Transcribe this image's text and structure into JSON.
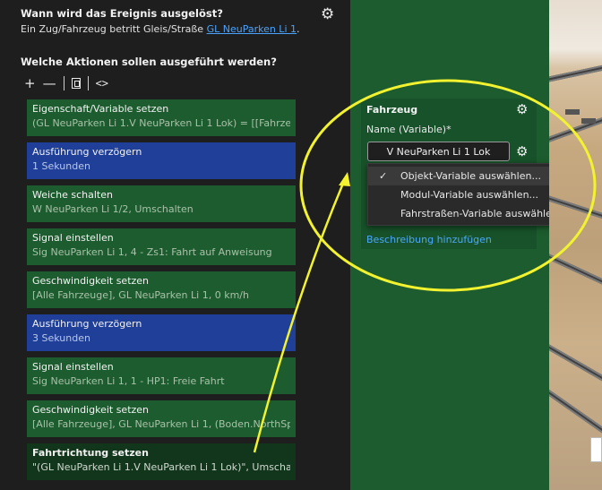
{
  "trigger": {
    "title": "Wann wird das Ereignis ausgelöst?",
    "text_prefix": "Ein Zug/Fahrzeug betritt Gleis/Straße ",
    "link": "GL NeuParken Li 1",
    "text_suffix": ".",
    "gear_icon": "gear-icon"
  },
  "actions_title": "Welche Aktionen sollen ausgeführt werden?",
  "toolbar": {
    "add": "+",
    "remove": "—",
    "code": "<>"
  },
  "actions": [
    {
      "title": "Eigenschaft/Variable setzen",
      "sub": "(GL NeuParken Li 1.V NeuParken Li 1 Lok) = [[Fahrze...",
      "style": "green"
    },
    {
      "title": "Ausführung verzögern",
      "sub": "1 Sekunden",
      "style": "blue"
    },
    {
      "title": "Weiche schalten",
      "sub": "W NeuParken Li 1/2, Umschalten",
      "style": "green"
    },
    {
      "title": "Signal einstellen",
      "sub": "Sig NeuParken Li 1, 4 - Zs1:  Fahrt auf Anweisung",
      "style": "green"
    },
    {
      "title": "Geschwindigkeit setzen",
      "sub": "[Alle Fahrzeuge], GL NeuParken Li 1, 0 km/h",
      "style": "green"
    },
    {
      "title": "Ausführung verzögern",
      "sub": "3 Sekunden",
      "style": "blue"
    },
    {
      "title": "Signal einstellen",
      "sub": "Sig NeuParken Li 1, 1 - HP1:  Freie Fahrt",
      "style": "green"
    },
    {
      "title": "Geschwindigkeit setzen",
      "sub": "[Alle Fahrzeuge], GL NeuParken Li 1, (Boden.NorthSp...",
      "style": "green"
    },
    {
      "title": "Fahrtrichtung setzen",
      "sub": "\"(GL NeuParken Li 1.V NeuParken Li 1 Lok)\", Umscha...",
      "style": "dark"
    }
  ],
  "vehicle_panel": {
    "title": "Fahrzeug",
    "name_label": "Name (Variable)*",
    "input_value": "V NeuParken Li 1 Lok",
    "description_link": "Beschreibung hinzufügen"
  },
  "dropdown": {
    "check": "✓",
    "items": [
      "Objekt-Variable auswählen...",
      "Modul-Variable auswählen...",
      "Fahrstraßen-Variable auswählen..."
    ],
    "selected_index": 0
  },
  "colors": {
    "panel_dark": "#1e1e1e",
    "action_green": "#1c5c2e",
    "action_blue": "#1f3f99",
    "link_blue": "#4aa3ff",
    "annotation_yellow": "#f2f230"
  }
}
